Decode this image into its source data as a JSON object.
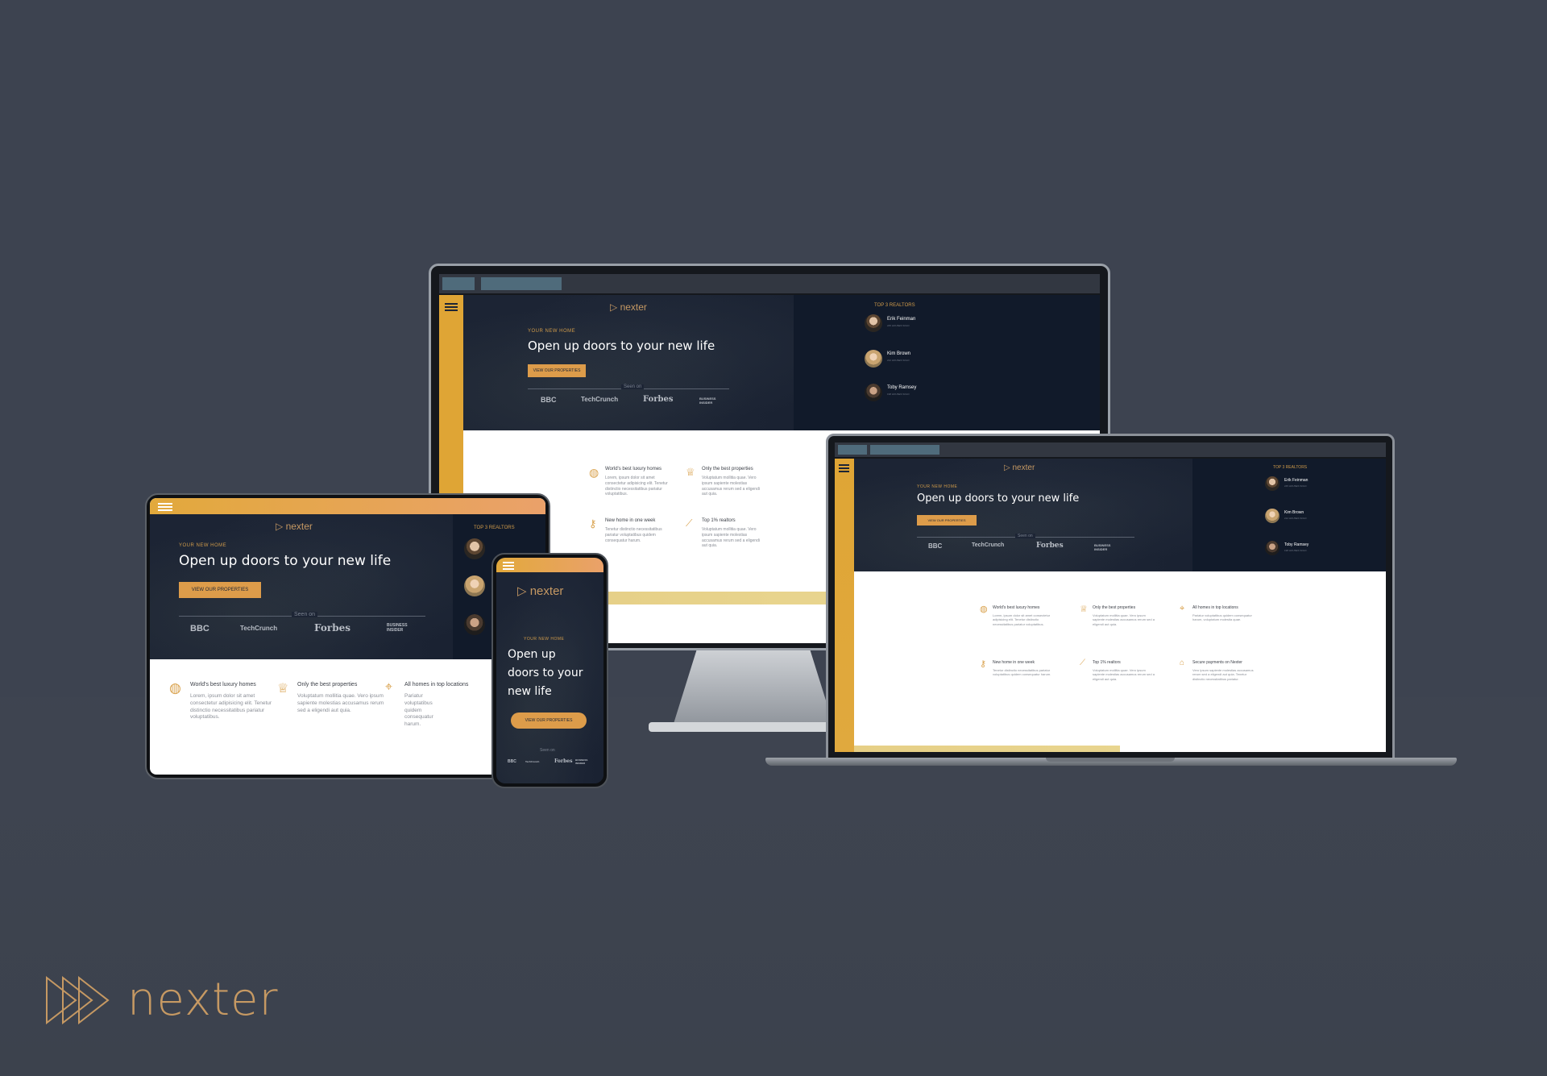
{
  "brand": {
    "name": "nexter"
  },
  "hero": {
    "tagline": "YOUR NEW HOME",
    "headline": "Open up doors to your new life",
    "headline_phone": [
      "Open up",
      "doors to your",
      "new life"
    ],
    "cta": "VIEW OUR PROPERTIES",
    "seen_on": "Seen on",
    "press_logos": [
      "BBC",
      "TechCrunch",
      "Forbes",
      "BUSINESS INSIDER"
    ]
  },
  "realtors": {
    "title": "TOP 3 REALTORS",
    "items": [
      {
        "name": "Erik Feinman",
        "sub": "245 HOUSES SOLD"
      },
      {
        "name": "Kim Brown",
        "sub": "212 HOUSES SOLD"
      },
      {
        "name": "Toby Ramsey",
        "sub": "198 HOUSES SOLD"
      }
    ]
  },
  "features": [
    {
      "icon": "globe-icon",
      "title": "World's best luxury homes",
      "text": "Lorem, ipsum dolor sit amet consectetur adipisicing elit. Tenetur distinctio necessitatibus pariatur voluptatibus."
    },
    {
      "icon": "trophy-icon",
      "title": "Only the best properties",
      "text": "Voluptatum mollitia quae. Vero ipsum sapiente molestias accusamus rerum sed a eligendi aut quia."
    },
    {
      "icon": "map-pin-icon",
      "title": "All homes in top locations",
      "text": "Pariatur voluptatibus quidem consequatur harum, voluptatum molestia quae."
    },
    {
      "icon": "key-icon",
      "title": "New home in one week",
      "text": "Tenetur distinctio necessitatibus pariatur voluptatibus quidem consequatur harum."
    },
    {
      "icon": "chart-icon",
      "title": "Top 1% realtors",
      "text": "Voluptatum mollitia quae. Vero ipsum sapiente molestias accusamus rerum sed a eligendi aut quia."
    },
    {
      "icon": "lock-icon",
      "title": "Secure payments on Nexter",
      "text": "Vero ipsum sapiente molestias accusamus rerum sed a eligendi aut quia. Tenetur distinctio necessitatibus pariatur."
    }
  ],
  "colors": {
    "background": "#3d4350",
    "navy": "#1d2535",
    "gold": "#c69963",
    "accent": "#dd9c4a"
  }
}
